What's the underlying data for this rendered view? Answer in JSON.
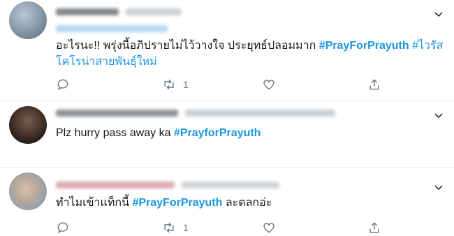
{
  "tweets": [
    {
      "text_main": "อะไรนะ!! พรุ่งนี้อภิปรายไม่ไว้วางใจ ประยุทธ์ปลอมมาก ",
      "hashtag_1": "#PrayForPrayuth",
      "hashtag_2": " #ไวรัส",
      "text_line2": "โคโรน่าสายพันธุ์ใหม่",
      "retweet_count": "1"
    },
    {
      "text_main": "Plz hurry pass away ka ",
      "hashtag_1": "#PrayforPrayuth"
    },
    {
      "text_main": "ทำไมเข้าแท็กนี้ ",
      "hashtag_1": "#PrayForPrayuth",
      "text_after": " ละตลกอ่ะ",
      "retweet_count": "1"
    }
  ],
  "icons": {
    "reply": "reply-icon",
    "retweet": "retweet-icon",
    "like": "heart-icon",
    "share": "share-icon",
    "more": "chevron-down-icon"
  },
  "colors": {
    "hashtag": "#1b95e0",
    "icon": "#657786",
    "divider": "#e6ecf0"
  }
}
